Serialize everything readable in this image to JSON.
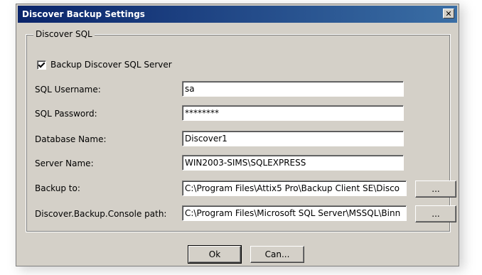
{
  "window": {
    "title": "Discover Backup Settings",
    "close_glyph": "✕"
  },
  "group": {
    "legend": "Discover SQL",
    "checkbox_label": "Backup Discover SQL Server",
    "checkbox_checked": true
  },
  "fields": {
    "username": {
      "label": "SQL Username:",
      "value": "sa"
    },
    "password": {
      "label": "SQL Password:",
      "value": "********"
    },
    "database": {
      "label": "Database Name:",
      "value": "Discover1"
    },
    "server": {
      "label": "Server Name:",
      "value": "WIN2003-SIMS\\SQLEXPRESS"
    },
    "backup_to": {
      "label": "Backup to:",
      "value": "C:\\Program Files\\Attix5 Pro\\Backup Client SE\\Disco"
    },
    "console_path": {
      "label": "Discover.Backup.Console path:",
      "value": "C:\\Program Files\\Microsoft SQL Server\\MSSQL\\Binn"
    }
  },
  "browse_label": "...",
  "buttons": {
    "ok": "Ok",
    "cancel": "Can..."
  }
}
